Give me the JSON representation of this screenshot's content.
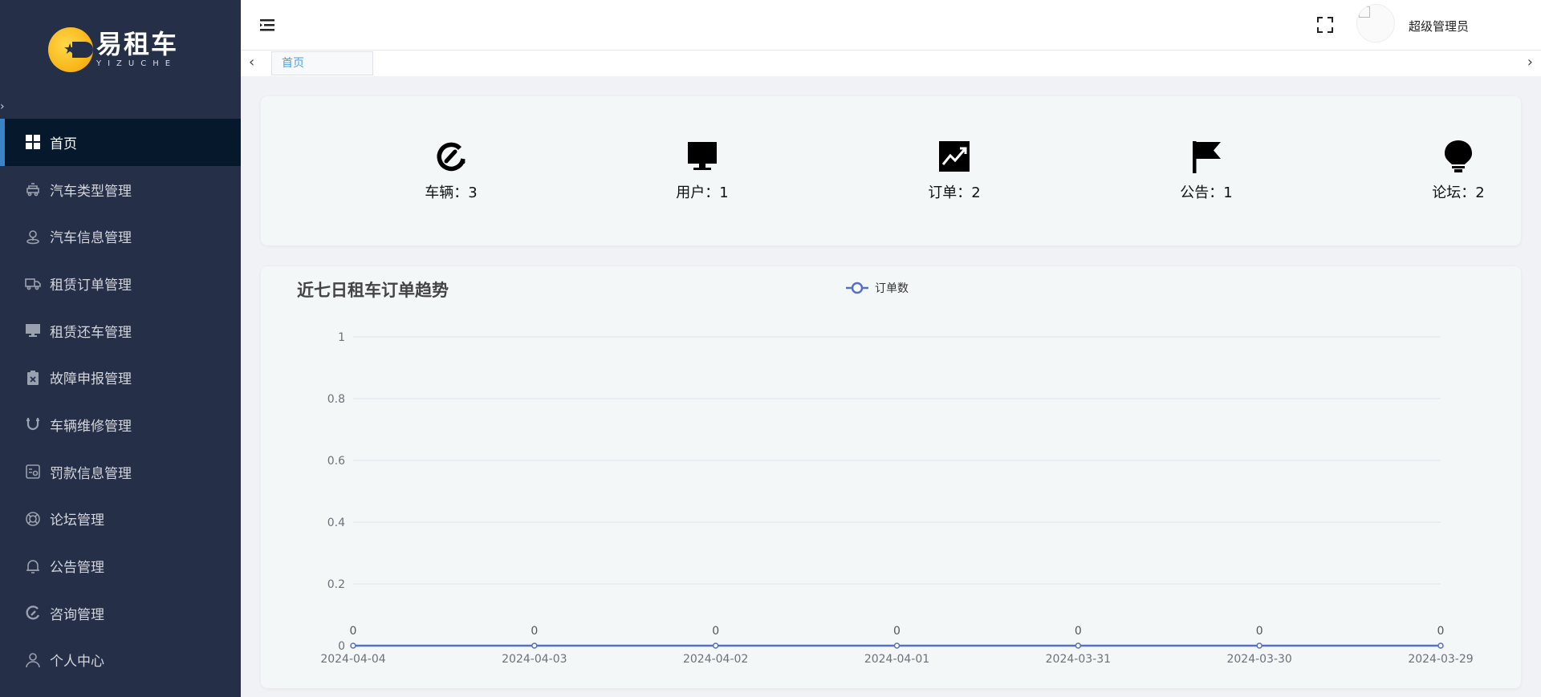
{
  "sidebar": {
    "logo": {
      "cn": "易租车",
      "en": "YIZUCHE"
    },
    "items": [
      {
        "label": "首页",
        "icon": "grid-icon",
        "active": true
      },
      {
        "label": "汽车类型管理",
        "icon": "car-type-icon",
        "active": false
      },
      {
        "label": "汽车信息管理",
        "icon": "location-icon",
        "active": false
      },
      {
        "label": "租赁订单管理",
        "icon": "truck-icon",
        "active": false
      },
      {
        "label": "租赁还车管理",
        "icon": "monitor-icon",
        "active": false
      },
      {
        "label": "故障申报管理",
        "icon": "report-icon",
        "active": false
      },
      {
        "label": "车辆维修管理",
        "icon": "magnet-icon",
        "active": false
      },
      {
        "label": "罚款信息管理",
        "icon": "fine-icon",
        "active": false
      },
      {
        "label": "论坛管理",
        "icon": "lifebuoy-icon",
        "active": false
      },
      {
        "label": "公告管理",
        "icon": "bell-icon",
        "active": false
      },
      {
        "label": "咨询管理",
        "icon": "chat-icon",
        "active": false
      },
      {
        "label": "个人中心",
        "icon": "user-icon",
        "active": false
      }
    ]
  },
  "header": {
    "username": "超级管理员"
  },
  "tabs": {
    "items": [
      {
        "label": "首页"
      }
    ]
  },
  "stats": [
    {
      "label": "车辆：3",
      "icon": "gauge-icon"
    },
    {
      "label": "用户：1",
      "icon": "monitor-icon"
    },
    {
      "label": "订单：2",
      "icon": "trend-icon"
    },
    {
      "label": "公告：1",
      "icon": "flag-icon"
    },
    {
      "label": "论坛：2",
      "icon": "bulb-icon"
    }
  ],
  "chart": {
    "title": "近七日租车订单趋势"
  },
  "chart_data": {
    "type": "line",
    "title": "近七日租车订单趋势",
    "x": [
      "2024-04-04",
      "2024-04-03",
      "2024-04-02",
      "2024-04-01",
      "2024-03-31",
      "2024-03-30",
      "2024-03-29"
    ],
    "series": [
      {
        "name": "订单数",
        "values": [
          0,
          0,
          0,
          0,
          0,
          0,
          0
        ],
        "color": "#5470c6"
      }
    ],
    "yticks": [
      "0",
      "0.2",
      "0.4",
      "0.6",
      "0.8",
      "1"
    ],
    "ylim": [
      0,
      1
    ],
    "xlabel": "",
    "ylabel": "",
    "grid": true,
    "legend": "top-center",
    "data_labels": true
  }
}
